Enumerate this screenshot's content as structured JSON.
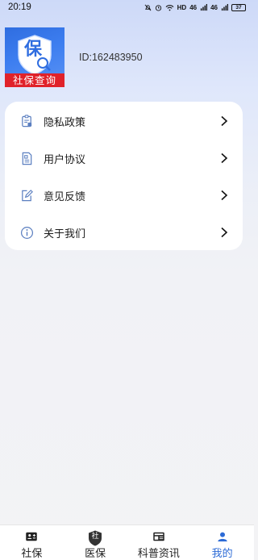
{
  "status_bar": {
    "time": "20:19",
    "hd_label": "HD",
    "network_1": "46",
    "network_2": "46",
    "battery": "37"
  },
  "profile": {
    "avatar_glyph": "保",
    "avatar_banner": "社保查询",
    "user_id": "ID:162483950"
  },
  "menu": {
    "items": [
      {
        "label": "隐私政策",
        "icon": "privacy-doc-icon"
      },
      {
        "label": "用户协议",
        "icon": "agreement-doc-icon"
      },
      {
        "label": "意见反馈",
        "icon": "feedback-edit-icon"
      },
      {
        "label": "关于我们",
        "icon": "info-icon"
      }
    ]
  },
  "bottom_nav": {
    "items": [
      {
        "label": "社保",
        "icon": "id-card-icon",
        "active": false
      },
      {
        "label": "医保",
        "icon": "shield-badge-icon",
        "icon_glyph": "社",
        "active": false
      },
      {
        "label": "科普资讯",
        "icon": "news-icon",
        "active": false
      },
      {
        "label": "我的",
        "icon": "user-icon",
        "active": true
      }
    ]
  },
  "colors": {
    "accent": "#2d6bd6",
    "banner_red": "#e0222a",
    "icon_blue": "#5b7fc0"
  }
}
